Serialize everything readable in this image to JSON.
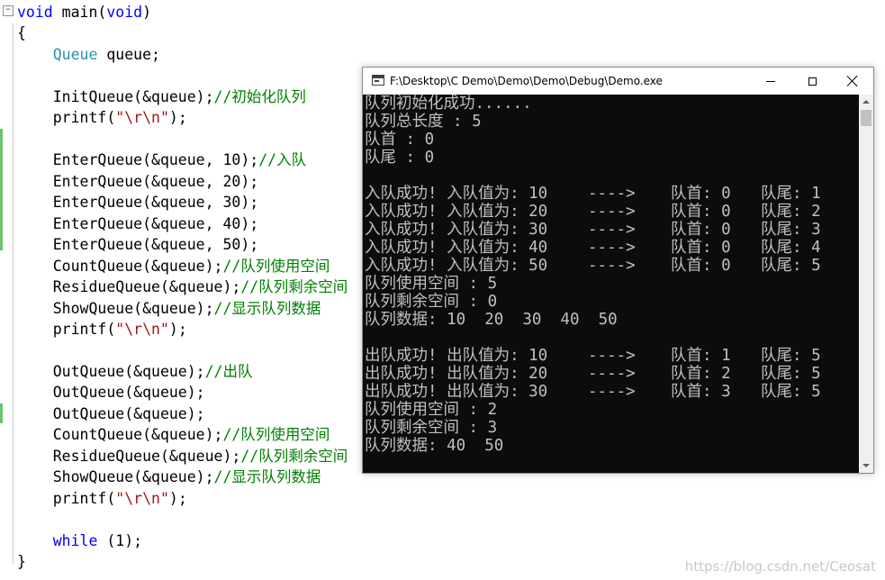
{
  "editor": {
    "lines": [
      [
        {
          "t": "void",
          "c": "kw"
        },
        {
          "t": " main("
        },
        {
          "t": "void",
          "c": "kw"
        },
        {
          "t": ")"
        }
      ],
      [
        {
          "t": "{"
        }
      ],
      [
        {
          "t": "    "
        },
        {
          "t": "Queue",
          "c": "ty"
        },
        {
          "t": " queue;"
        }
      ],
      [],
      [
        {
          "t": "    InitQueue(&queue);"
        },
        {
          "t": "//初始化队列",
          "c": "cm"
        }
      ],
      [
        {
          "t": "    printf("
        },
        {
          "t": "\"\\r\\n\"",
          "c": "st"
        },
        {
          "t": ");"
        }
      ],
      [],
      [
        {
          "t": "    EnterQueue(&queue, 10);"
        },
        {
          "t": "//入队",
          "c": "cm"
        }
      ],
      [
        {
          "t": "    EnterQueue(&queue, 20);"
        }
      ],
      [
        {
          "t": "    EnterQueue(&queue, 30);"
        }
      ],
      [
        {
          "t": "    EnterQueue(&queue, 40);"
        }
      ],
      [
        {
          "t": "    EnterQueue(&queue, 50);"
        }
      ],
      [
        {
          "t": "    CountQueue(&queue);"
        },
        {
          "t": "//队列使用空间",
          "c": "cm"
        }
      ],
      [
        {
          "t": "    ResidueQueue(&queue);"
        },
        {
          "t": "//队列剩余空间",
          "c": "cm"
        }
      ],
      [
        {
          "t": "    ShowQueue(&queue);"
        },
        {
          "t": "//显示队列数据",
          "c": "cm"
        }
      ],
      [
        {
          "t": "    printf("
        },
        {
          "t": "\"\\r\\n\"",
          "c": "st"
        },
        {
          "t": ");"
        }
      ],
      [],
      [
        {
          "t": "    OutQueue(&queue);"
        },
        {
          "t": "//出队",
          "c": "cm"
        }
      ],
      [
        {
          "t": "    OutQueue(&queue);"
        }
      ],
      [
        {
          "t": "    OutQueue(&queue);"
        }
      ],
      [
        {
          "t": "    CountQueue(&queue);"
        },
        {
          "t": "//队列使用空间",
          "c": "cm"
        }
      ],
      [
        {
          "t": "    ResidueQueue(&queue);"
        },
        {
          "t": "//队列剩余空间",
          "c": "cm"
        }
      ],
      [
        {
          "t": "    ShowQueue(&queue);"
        },
        {
          "t": "//显示队列数据",
          "c": "cm"
        }
      ],
      [
        {
          "t": "    printf("
        },
        {
          "t": "\"\\r\\n\"",
          "c": "st"
        },
        {
          "t": ");"
        }
      ],
      [],
      [
        {
          "t": "    "
        },
        {
          "t": "while",
          "c": "kw"
        },
        {
          "t": " (1);"
        }
      ],
      [
        {
          "t": "}"
        }
      ]
    ]
  },
  "console": {
    "title": "F:\\Desktop\\C Demo\\Demo\\Demo\\Debug\\Demo.exe",
    "lines": [
      [
        "队列初始化成功......"
      ],
      [
        "队列总长度 : 5"
      ],
      [
        "队首 : 0"
      ],
      [
        "队尾 : 0"
      ],
      [
        ""
      ],
      [
        "入队成功! 入队值为: 10",
        "---->",
        "队首: 0",
        "队尾: 1"
      ],
      [
        "入队成功! 入队值为: 20",
        "---->",
        "队首: 0",
        "队尾: 2"
      ],
      [
        "入队成功! 入队值为: 30",
        "---->",
        "队首: 0",
        "队尾: 3"
      ],
      [
        "入队成功! 入队值为: 40",
        "---->",
        "队首: 0",
        "队尾: 4"
      ],
      [
        "入队成功! 入队值为: 50",
        "---->",
        "队首: 0",
        "队尾: 5"
      ],
      [
        "队列使用空间 : 5"
      ],
      [
        "队列剩余空间 : 0"
      ],
      [
        "队列数据: 10  20  30  40  50"
      ],
      [
        ""
      ],
      [
        "出队成功! 出队值为: 10",
        "---->",
        "队首: 1",
        "队尾: 5"
      ],
      [
        "出队成功! 出队值为: 20",
        "---->",
        "队首: 2",
        "队尾: 5"
      ],
      [
        "出队成功! 出队值为: 30",
        "---->",
        "队首: 3",
        "队尾: 5"
      ],
      [
        "队列使用空间 : 2"
      ],
      [
        "队列剩余空间 : 3"
      ],
      [
        "队列数据: 40  50"
      ]
    ]
  },
  "watermark": "https://blog.csdn.net/Ceosat",
  "colors": {
    "keyword": "#0000ff",
    "type": "#2b91af",
    "comment": "#008000",
    "string": "#a31515",
    "console_bg": "#0c0c0c",
    "console_text": "#c0c0c0"
  },
  "icons": {
    "collapse": "minus-box-icon",
    "app": "console-window-icon",
    "minimize": "minimize-icon",
    "maximize": "maximize-icon",
    "close": "close-icon"
  }
}
